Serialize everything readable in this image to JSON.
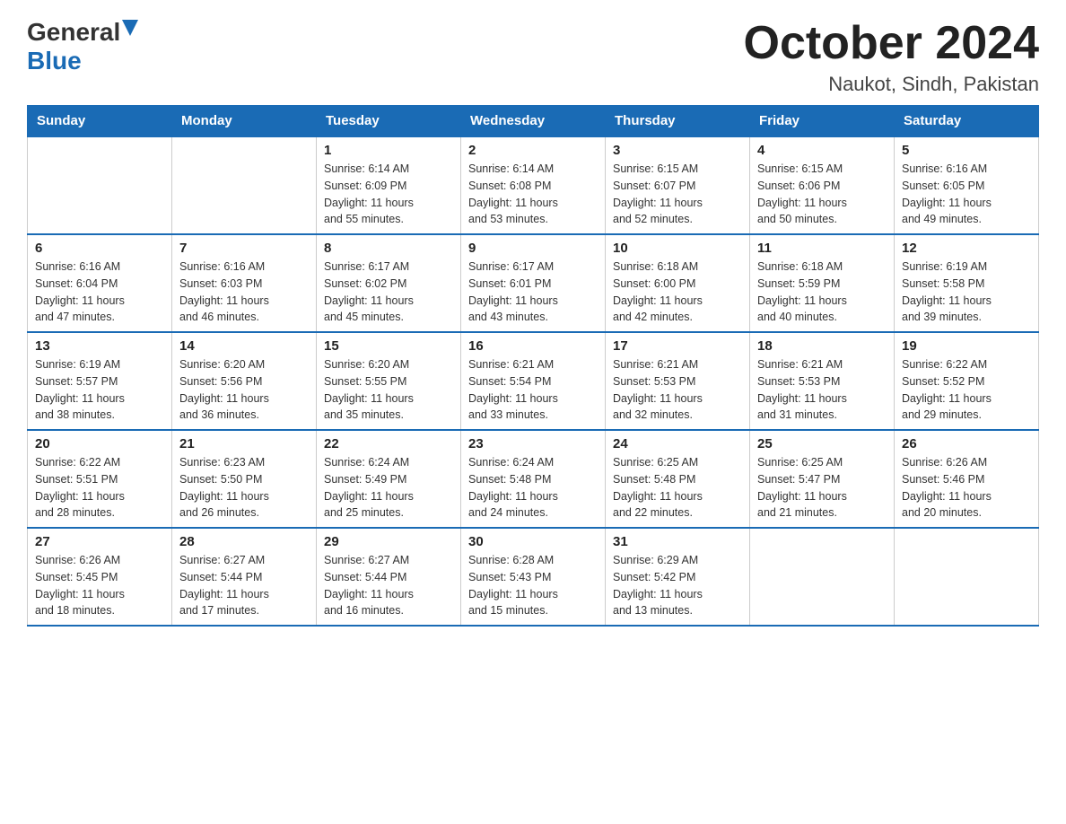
{
  "header": {
    "logo_general": "General",
    "logo_blue": "Blue",
    "month_title": "October 2024",
    "location": "Naukot, Sindh, Pakistan"
  },
  "weekdays": [
    "Sunday",
    "Monday",
    "Tuesday",
    "Wednesday",
    "Thursday",
    "Friday",
    "Saturday"
  ],
  "weeks": [
    [
      {
        "day": "",
        "info": ""
      },
      {
        "day": "",
        "info": ""
      },
      {
        "day": "1",
        "info": "Sunrise: 6:14 AM\nSunset: 6:09 PM\nDaylight: 11 hours\nand 55 minutes."
      },
      {
        "day": "2",
        "info": "Sunrise: 6:14 AM\nSunset: 6:08 PM\nDaylight: 11 hours\nand 53 minutes."
      },
      {
        "day": "3",
        "info": "Sunrise: 6:15 AM\nSunset: 6:07 PM\nDaylight: 11 hours\nand 52 minutes."
      },
      {
        "day": "4",
        "info": "Sunrise: 6:15 AM\nSunset: 6:06 PM\nDaylight: 11 hours\nand 50 minutes."
      },
      {
        "day": "5",
        "info": "Sunrise: 6:16 AM\nSunset: 6:05 PM\nDaylight: 11 hours\nand 49 minutes."
      }
    ],
    [
      {
        "day": "6",
        "info": "Sunrise: 6:16 AM\nSunset: 6:04 PM\nDaylight: 11 hours\nand 47 minutes."
      },
      {
        "day": "7",
        "info": "Sunrise: 6:16 AM\nSunset: 6:03 PM\nDaylight: 11 hours\nand 46 minutes."
      },
      {
        "day": "8",
        "info": "Sunrise: 6:17 AM\nSunset: 6:02 PM\nDaylight: 11 hours\nand 45 minutes."
      },
      {
        "day": "9",
        "info": "Sunrise: 6:17 AM\nSunset: 6:01 PM\nDaylight: 11 hours\nand 43 minutes."
      },
      {
        "day": "10",
        "info": "Sunrise: 6:18 AM\nSunset: 6:00 PM\nDaylight: 11 hours\nand 42 minutes."
      },
      {
        "day": "11",
        "info": "Sunrise: 6:18 AM\nSunset: 5:59 PM\nDaylight: 11 hours\nand 40 minutes."
      },
      {
        "day": "12",
        "info": "Sunrise: 6:19 AM\nSunset: 5:58 PM\nDaylight: 11 hours\nand 39 minutes."
      }
    ],
    [
      {
        "day": "13",
        "info": "Sunrise: 6:19 AM\nSunset: 5:57 PM\nDaylight: 11 hours\nand 38 minutes."
      },
      {
        "day": "14",
        "info": "Sunrise: 6:20 AM\nSunset: 5:56 PM\nDaylight: 11 hours\nand 36 minutes."
      },
      {
        "day": "15",
        "info": "Sunrise: 6:20 AM\nSunset: 5:55 PM\nDaylight: 11 hours\nand 35 minutes."
      },
      {
        "day": "16",
        "info": "Sunrise: 6:21 AM\nSunset: 5:54 PM\nDaylight: 11 hours\nand 33 minutes."
      },
      {
        "day": "17",
        "info": "Sunrise: 6:21 AM\nSunset: 5:53 PM\nDaylight: 11 hours\nand 32 minutes."
      },
      {
        "day": "18",
        "info": "Sunrise: 6:21 AM\nSunset: 5:53 PM\nDaylight: 11 hours\nand 31 minutes."
      },
      {
        "day": "19",
        "info": "Sunrise: 6:22 AM\nSunset: 5:52 PM\nDaylight: 11 hours\nand 29 minutes."
      }
    ],
    [
      {
        "day": "20",
        "info": "Sunrise: 6:22 AM\nSunset: 5:51 PM\nDaylight: 11 hours\nand 28 minutes."
      },
      {
        "day": "21",
        "info": "Sunrise: 6:23 AM\nSunset: 5:50 PM\nDaylight: 11 hours\nand 26 minutes."
      },
      {
        "day": "22",
        "info": "Sunrise: 6:24 AM\nSunset: 5:49 PM\nDaylight: 11 hours\nand 25 minutes."
      },
      {
        "day": "23",
        "info": "Sunrise: 6:24 AM\nSunset: 5:48 PM\nDaylight: 11 hours\nand 24 minutes."
      },
      {
        "day": "24",
        "info": "Sunrise: 6:25 AM\nSunset: 5:48 PM\nDaylight: 11 hours\nand 22 minutes."
      },
      {
        "day": "25",
        "info": "Sunrise: 6:25 AM\nSunset: 5:47 PM\nDaylight: 11 hours\nand 21 minutes."
      },
      {
        "day": "26",
        "info": "Sunrise: 6:26 AM\nSunset: 5:46 PM\nDaylight: 11 hours\nand 20 minutes."
      }
    ],
    [
      {
        "day": "27",
        "info": "Sunrise: 6:26 AM\nSunset: 5:45 PM\nDaylight: 11 hours\nand 18 minutes."
      },
      {
        "day": "28",
        "info": "Sunrise: 6:27 AM\nSunset: 5:44 PM\nDaylight: 11 hours\nand 17 minutes."
      },
      {
        "day": "29",
        "info": "Sunrise: 6:27 AM\nSunset: 5:44 PM\nDaylight: 11 hours\nand 16 minutes."
      },
      {
        "day": "30",
        "info": "Sunrise: 6:28 AM\nSunset: 5:43 PM\nDaylight: 11 hours\nand 15 minutes."
      },
      {
        "day": "31",
        "info": "Sunrise: 6:29 AM\nSunset: 5:42 PM\nDaylight: 11 hours\nand 13 minutes."
      },
      {
        "day": "",
        "info": ""
      },
      {
        "day": "",
        "info": ""
      }
    ]
  ]
}
